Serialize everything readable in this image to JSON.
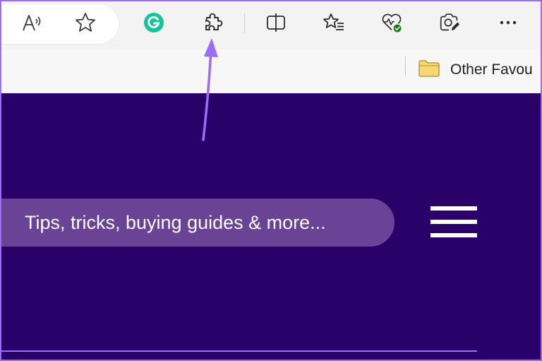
{
  "toolbar": {
    "icons": [
      {
        "name": "read-aloud-icon"
      },
      {
        "name": "favorite-star-icon"
      },
      {
        "name": "grammarly-extension-icon",
        "color": "#15c39a"
      },
      {
        "name": "extensions-puzzle-icon"
      },
      {
        "name": "split-screen-icon"
      },
      {
        "name": "favorites-list-icon"
      },
      {
        "name": "browser-essentials-icon",
        "badge_color": "#107c10"
      },
      {
        "name": "web-capture-icon"
      },
      {
        "name": "more-options-icon"
      }
    ]
  },
  "favorites_bar": {
    "folder_label": "Other Favou",
    "folder_icon": "folder-icon",
    "folder_color": "#f7d774"
  },
  "page": {
    "search_placeholder": "Tips, tricks, buying guides & more...",
    "menu_icon": "hamburger-menu-icon",
    "background_color": "#2a0069",
    "search_pill_color": "#6a4396"
  },
  "annotation": {
    "arrow_color": "#9b6cf5",
    "points_to": "extensions-puzzle-icon"
  }
}
